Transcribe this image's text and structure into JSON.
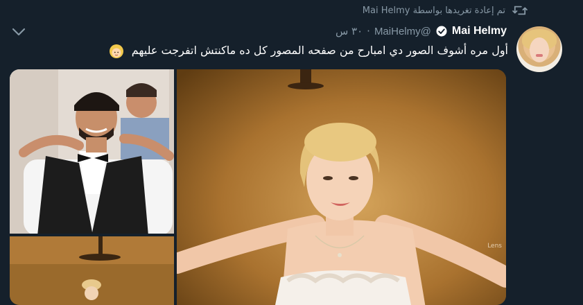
{
  "retweet": {
    "text": "تم إعادة تغريدها بواسطة Mai Helmy",
    "icon": "retweet-icon"
  },
  "tweet": {
    "display_name": "Mai Helmy",
    "handle": "@MaiHelmy",
    "separator": "·",
    "timestamp": "٣٠ س",
    "text": "أول مره أشوف الصور دي امبارح من صفحه المصور كل ده ماكنتش اتفرجت عليهم",
    "emoji": "woman-blond-hair-emoji"
  },
  "media": {
    "photos": [
      {
        "name": "groom-photo"
      },
      {
        "name": "studio-photo"
      },
      {
        "name": "bride-photo"
      }
    ],
    "watermark": "Lens"
  },
  "colors": {
    "background": "#15202b",
    "text_primary": "#ffffff",
    "text_secondary": "#8899a6",
    "verified": "#ffffff"
  }
}
